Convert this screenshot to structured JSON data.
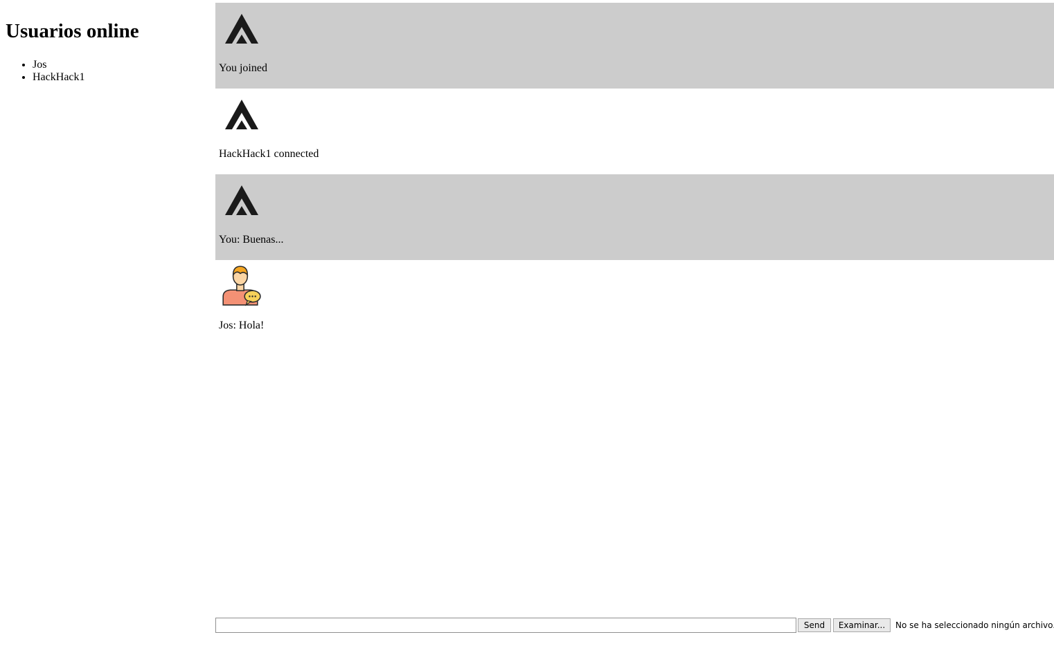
{
  "sidebar": {
    "title": "Usuarios online",
    "users": [
      "Jos",
      "HackHack1"
    ]
  },
  "messages": [
    {
      "text": "You joined",
      "avatar": "apex-logo-icon",
      "shaded": true
    },
    {
      "text": "HackHack1 connected",
      "avatar": "apex-logo-icon",
      "shaded": false
    },
    {
      "text": "You: Buenas...",
      "avatar": "apex-logo-icon",
      "shaded": true
    },
    {
      "text": "Jos: Hola!",
      "avatar": "user-chat-avatar-icon",
      "shaded": false
    }
  ],
  "composer": {
    "message_value": "",
    "send_label": "Send",
    "browse_label": "Examinar...",
    "file_status": "No se ha seleccionado ningún archivo."
  },
  "colors": {
    "shaded_row": "#cccccc",
    "logo": "#1a1a1a"
  }
}
